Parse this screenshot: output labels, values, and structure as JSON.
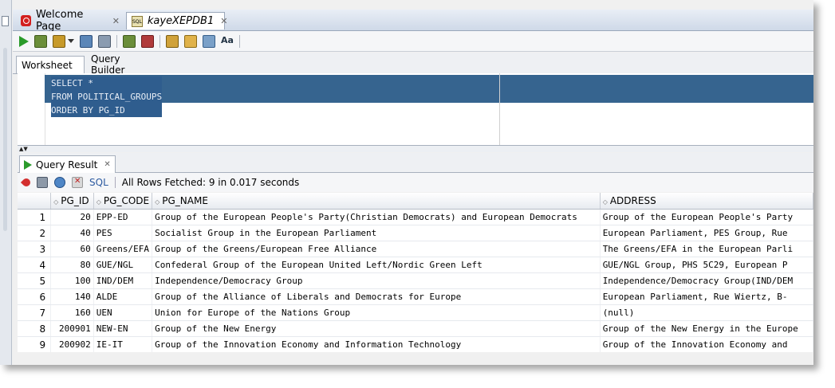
{
  "tabs": [
    {
      "label": "Welcome Page",
      "icon": "oracle-icon"
    },
    {
      "label": "kayeXEPDB1",
      "icon": "sql-file-icon"
    }
  ],
  "subtabs": [
    "Worksheet",
    "Query Builder"
  ],
  "editor": {
    "lines": [
      "SELECT *",
      "FROM POLITICAL_GROUPS",
      "ORDER BY PG_ID"
    ]
  },
  "result": {
    "tab_label": "Query Result",
    "sql_label": "SQL",
    "status": "All Rows Fetched: 9 in 0.017 seconds",
    "columns": [
      "PG_ID",
      "PG_CODE",
      "PG_NAME",
      "ADDRESS"
    ],
    "rows": [
      {
        "n": "1",
        "id": "20",
        "code": "EPP-ED",
        "name": "Group of the European People's Party(Christian Democrats) and European Democrats",
        "addr": "Group of the European People's Party"
      },
      {
        "n": "2",
        "id": "40",
        "code": "PES",
        "name": "Socialist Group in the European Parliament",
        "addr": "European Parliament, PES Group, Rue"
      },
      {
        "n": "3",
        "id": "60",
        "code": "Greens/EFA",
        "name": "Group of the Greens/European Free Alliance",
        "addr": "The Greens/EFA in the European Parli"
      },
      {
        "n": "4",
        "id": "80",
        "code": "GUE/NGL",
        "name": "Confederal Group of the European United Left/Nordic Green Left",
        "addr": "GUE/NGL Group, PHS 5C29, European P"
      },
      {
        "n": "5",
        "id": "100",
        "code": "IND/DEM",
        "name": "Independence/Democracy Group",
        "addr": "Independence/Democracy Group(IND/DEM"
      },
      {
        "n": "6",
        "id": "140",
        "code": "ALDE",
        "name": "Group of the Alliance of Liberals and Democrats for Europe",
        "addr": "European Parliament, Rue Wiertz, B-"
      },
      {
        "n": "7",
        "id": "160",
        "code": "UEN",
        "name": "Union for Europe of the Nations Group",
        "addr": "(null)"
      },
      {
        "n": "8",
        "id": "200901",
        "code": "NEW-EN",
        "name": "Group of the New Energy",
        "addr": "Group of the New Energy in the Europe"
      },
      {
        "n": "9",
        "id": "200902",
        "code": "IE-IT",
        "name": "Group of the Innovation Economy and Information Technology",
        "addr": "Group of the Innovation Economy and"
      }
    ]
  }
}
